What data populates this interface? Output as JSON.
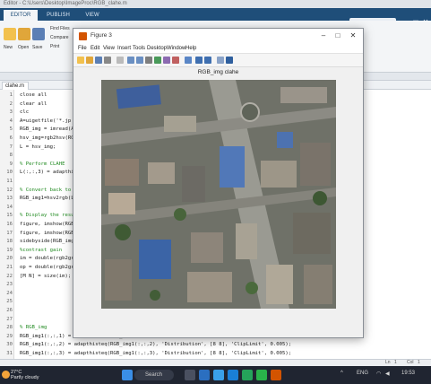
{
  "main_window": {
    "title": "Editor - C:\\Users\\Desktop\\ImageProc\\RGB_clahe.m",
    "tabs": [
      "EDITOR",
      "PUBLISH",
      "VIEW"
    ],
    "ribbon_labels": {
      "find_files": "Find Files",
      "compare": "Compare",
      "print": "Print",
      "new": "New",
      "open": "Open",
      "save": "Save"
    },
    "file_tab": "clahe.m",
    "status": {
      "line_label": "Ln",
      "line": "1",
      "col_label": "Col",
      "col": "1"
    }
  },
  "editor": {
    "lines": [
      {
        "n": "1",
        "text": "close all",
        "kind": "code"
      },
      {
        "n": "2",
        "text": "clear all",
        "kind": "code"
      },
      {
        "n": "3",
        "text": "clc",
        "kind": "code"
      },
      {
        "n": "4",
        "text": "A=uigetfile('*.jp",
        "kind": "code"
      },
      {
        "n": "5",
        "text": "RGB_img = imread(A",
        "kind": "code"
      },
      {
        "n": "6",
        "text": "hsv_img=rgb2hsv(RGB",
        "kind": "code"
      },
      {
        "n": "7",
        "text": "L = hsv_img;",
        "kind": "code"
      },
      {
        "n": "8",
        "text": "",
        "kind": "code"
      },
      {
        "n": "9",
        "text": "% Perform CLAHE",
        "kind": "comment"
      },
      {
        "n": "10",
        "text": "L(:,:,3) = adapthis",
        "kind": "code"
      },
      {
        "n": "11",
        "text": "",
        "kind": "code"
      },
      {
        "n": "12",
        "text": "% Convert back to",
        "kind": "comment"
      },
      {
        "n": "13",
        "text": "RGB_img1=hsv2rgb(L",
        "kind": "code"
      },
      {
        "n": "14",
        "text": "",
        "kind": "code"
      },
      {
        "n": "15",
        "text": "% Display the resu",
        "kind": "comment"
      },
      {
        "n": "16",
        "text": "figure, imshow(RGB",
        "kind": "code"
      },
      {
        "n": "17",
        "text": "figure, imshow(RGB",
        "kind": "code"
      },
      {
        "n": "18",
        "text": "sidebyside(RGB_img",
        "kind": "code"
      },
      {
        "n": "19",
        "text": "%contrast gain",
        "kind": "comment"
      },
      {
        "n": "20",
        "text": "im = double(rgb2gra",
        "kind": "code"
      },
      {
        "n": "21",
        "text": "op = double(rgb2gra",
        "kind": "code"
      },
      {
        "n": "22",
        "text": "[M N] = size(im);",
        "kind": "code"
      },
      {
        "n": "23",
        "text": "",
        "kind": "code"
      },
      {
        "n": "24",
        "text": "",
        "kind": "code"
      },
      {
        "n": "25",
        "text": "",
        "kind": "code"
      },
      {
        "n": "26",
        "text": "",
        "kind": "code"
      },
      {
        "n": "27",
        "text": "",
        "kind": "code"
      },
      {
        "n": "28",
        "text": "% RGB_img",
        "kind": "comment"
      },
      {
        "n": "29",
        "text": "RGB_img1(:,:,1) = adapthisteq(RGB_img1(:,:,1), 'Distribution', [8 8], 'ClipLimit', 0.005);",
        "kind": "code"
      },
      {
        "n": "30",
        "text": "RGB_img1(:,:,2) = adapthisteq(RGB_img1(:,:,2), 'Distribution', [8 8], 'ClipLimit', 0.005);",
        "kind": "code"
      },
      {
        "n": "31",
        "text": "RGB_img1(:,:,3) = adapthisteq(RGB_img1(:,:,3), 'Distribution', [8 8], 'ClipLimit', 0.005);",
        "kind": "code"
      }
    ]
  },
  "figure": {
    "title": "Figure 3",
    "menu": [
      "File",
      "Edit",
      "View",
      "Insert",
      "Tools",
      "Desktop",
      "Window",
      "Help"
    ],
    "axes_title": "RGB_img clahe",
    "controls": {
      "minimize": "–",
      "maximize": "□",
      "close": "✕"
    }
  },
  "taskbar": {
    "weather_temp": "27°C",
    "weather_desc": "Partly cloudy",
    "search_label": "Search",
    "language": "ENG",
    "time": "19:53"
  },
  "colors": {
    "ribbon_blue": "#1f4e79",
    "taskbar": "#202531",
    "figure_bg": "#f0f0f0",
    "comment_green": "#228b22",
    "string_purple": "#a020f0"
  }
}
